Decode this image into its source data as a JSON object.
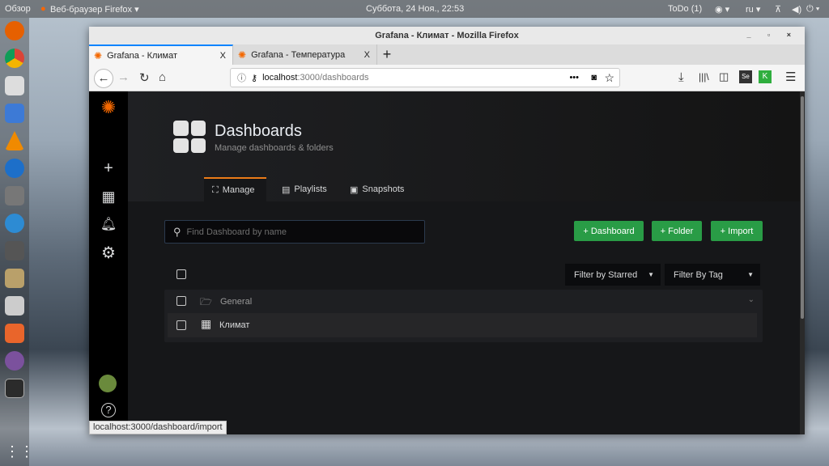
{
  "topbar": {
    "overview": "Обзор",
    "app": "Веб-браузер Firefox ▾",
    "datetime": "Суббота, 24 Ноя., 22:53",
    "todo": "ToDo (1)",
    "lang": "ru ▾"
  },
  "window": {
    "title": "Grafana - Климат - Mozilla Firefox"
  },
  "tabs": [
    {
      "label": "Grafana - Климат"
    },
    {
      "label": "Grafana - Температура"
    }
  ],
  "url": {
    "host": "localhost",
    "path": ":3000/dashboards"
  },
  "page": {
    "title": "Dashboards",
    "subtitle": "Manage dashboards & folders",
    "tabs": [
      "Manage",
      "Playlists",
      "Snapshots"
    ],
    "search_placeholder": "Find Dashboard by name",
    "buttons": [
      "+ Dashboard",
      "+ Folder",
      "+ Import"
    ],
    "filters": [
      "Filter by Starred",
      "Filter By Tag"
    ],
    "folder": "General",
    "dashboard": "Климат"
  },
  "status": "localhost:3000/dashboard/import",
  "colors": {
    "accent": "#299c46",
    "tab_highlight": "#eb7b18"
  }
}
